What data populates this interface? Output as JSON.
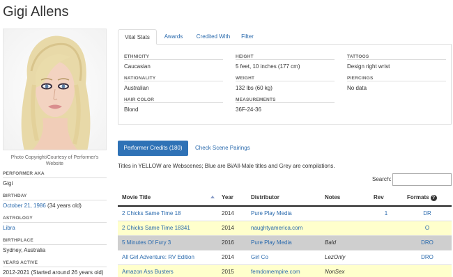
{
  "page_title": "Gigi Allens",
  "photo_credit": "Photo Copyright/Courtesy of Performer's Website",
  "left_info": [
    {
      "label": "Performer AKA",
      "value": "Gigi",
      "link": ""
    },
    {
      "label": "Birthday",
      "value": "",
      "link": "October 21, 1986",
      "suffix": " (34 years old)"
    },
    {
      "label": "Astrology",
      "value": "",
      "link": "Libra"
    },
    {
      "label": "Birthplace",
      "value": "Sydney, Australia",
      "link": ""
    },
    {
      "label": "Years Active",
      "value": "2012-2021 (Started around 26 years old)",
      "link": ""
    }
  ],
  "tabs": [
    "Vital Stats",
    "Awards",
    "Credited With",
    "Filter"
  ],
  "vital_stats": {
    "ethnicity": {
      "label": "Ethnicity",
      "value": "Caucasian"
    },
    "nationality": {
      "label": "Nationality",
      "value": "Australian"
    },
    "hair_color": {
      "label": "Hair Color",
      "value": "Blond"
    },
    "height": {
      "label": "Height",
      "value": "5 feet, 10 inches (177 cm)"
    },
    "weight": {
      "label": "Weight",
      "value": "132 lbs (60 kg)"
    },
    "measurements": {
      "label": "Measurements",
      "value": "36F-24-36"
    },
    "tattoos": {
      "label": "Tattoos",
      "value": "Design right wrist"
    },
    "piercings": {
      "label": "Piercings",
      "value": "No data"
    }
  },
  "credits": {
    "button_label": "Performer Credits (180)",
    "pairings_link": "Check Scene Pairings",
    "legend": "Titles in YELLOW are Webscenes; Blue are Bi/All-Male titles and Grey are compilations.",
    "search_label": "Search:",
    "search_value": "",
    "columns": {
      "title": "Movie Title",
      "year": "Year",
      "distributor": "Distributor",
      "notes": "Notes",
      "rev": "Rev",
      "formats": "Formats"
    },
    "help_icon": "?",
    "rows": [
      {
        "title": "2 Chicks Same Time 18",
        "year": "2014",
        "distributor": "Pure Play Media",
        "notes": "",
        "rev": "1",
        "formats": "DR",
        "color": "white"
      },
      {
        "title": "2 Chicks Same Time 18341",
        "year": "2014",
        "distributor": "naughtyamerica.com",
        "notes": "",
        "rev": "",
        "formats": "O",
        "color": "yellow"
      },
      {
        "title": "5 Minutes Of Fury 3",
        "year": "2016",
        "distributor": "Pure Play Media",
        "notes": "Bald",
        "rev": "",
        "formats": "DRO",
        "color": "grey"
      },
      {
        "title": "All Girl Adventure: RV Edition",
        "year": "2014",
        "distributor": "Girl Co",
        "notes": "LezOnly",
        "rev": "",
        "formats": "DRO",
        "color": "white"
      },
      {
        "title": "Amazon Ass Busters",
        "year": "2015",
        "distributor": "femdomempire.com",
        "notes": "NonSex",
        "rev": "",
        "formats": "",
        "color": "yellow"
      }
    ]
  }
}
